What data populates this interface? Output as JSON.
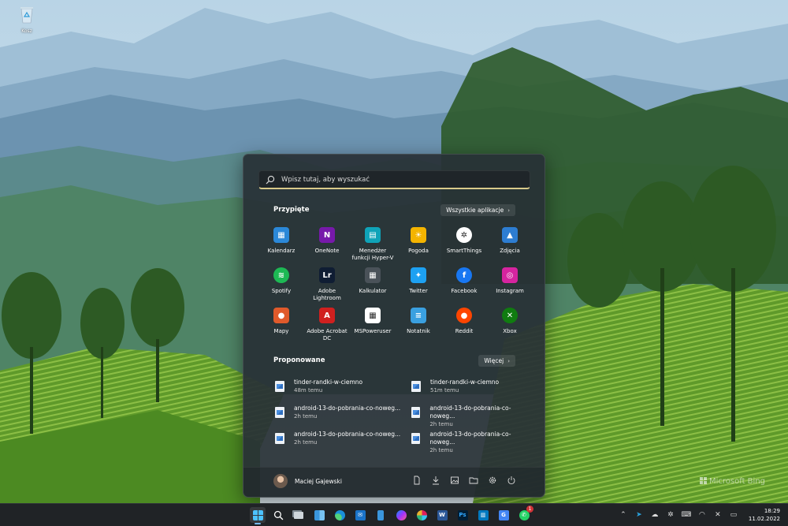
{
  "desktop": {
    "recycle_bin_label": "Kosz",
    "watermark": "Microsoft Bing"
  },
  "start_menu": {
    "search": {
      "placeholder": "Wpisz tutaj, aby wyszukać"
    },
    "pinned": {
      "title": "Przypięte",
      "all_apps_label": "Wszystkie aplikacje",
      "apps": [
        {
          "name": "Kalendarz",
          "icon": "calendar-icon",
          "color": "#2b88d8"
        },
        {
          "name": "OneNote",
          "icon": "onenote-icon",
          "color": "#7719aa"
        },
        {
          "name": "Menedżer funkcji Hyper-V",
          "icon": "hyperv-icon",
          "color": "#0fa3b8"
        },
        {
          "name": "Pogoda",
          "icon": "weather-icon",
          "color": "#f4b400"
        },
        {
          "name": "SmartThings",
          "icon": "smartthings-icon",
          "color": "#ffffff"
        },
        {
          "name": "Zdjęcia",
          "icon": "photos-icon",
          "color": "#2d7dd2"
        },
        {
          "name": "Spotify",
          "icon": "spotify-icon",
          "color": "#1db954"
        },
        {
          "name": "Adobe Lightroom",
          "icon": "lightroom-icon",
          "color": "#0f1d33"
        },
        {
          "name": "Kalkulator",
          "icon": "calculator-icon",
          "color": "#4a5259"
        },
        {
          "name": "Twitter",
          "icon": "twitter-icon",
          "color": "#1da1f2"
        },
        {
          "name": "Facebook",
          "icon": "facebook-icon",
          "color": "#1877f2"
        },
        {
          "name": "Instagram",
          "icon": "instagram-icon",
          "color": "#d6249f"
        },
        {
          "name": "Mapy",
          "icon": "maps-icon",
          "color": "#e05a2b"
        },
        {
          "name": "Adobe Acrobat DC",
          "icon": "acrobat-icon",
          "color": "#d0201f"
        },
        {
          "name": "MSPoweruser",
          "icon": "mspoweruser-icon",
          "color": "#ffffff"
        },
        {
          "name": "Notatnik",
          "icon": "notepad-icon",
          "color": "#3aa0e0"
        },
        {
          "name": "Reddit",
          "icon": "reddit-icon",
          "color": "#ff4500"
        },
        {
          "name": "Xbox",
          "icon": "xbox-icon",
          "color": "#107c10"
        }
      ]
    },
    "recommended": {
      "title": "Proponowane",
      "more_label": "Więcej",
      "items": [
        {
          "name": "tinder-randki-w-ciemno",
          "time": "48m temu"
        },
        {
          "name": "tinder-randki-w-ciemno",
          "time": "51m temu"
        },
        {
          "name": "android-13-do-pobrania-co-noweg...",
          "time": "2h temu"
        },
        {
          "name": "android-13-do-pobrania-co-noweg...",
          "time": "2h temu"
        },
        {
          "name": "android-13-do-pobrania-co-noweg...",
          "time": "2h temu"
        },
        {
          "name": "android-13-do-pobrania-co-noweg...",
          "time": "2h temu"
        }
      ]
    },
    "user": {
      "name": "Maciej Gajewski"
    }
  },
  "taskbar": {
    "notification_badge": "1",
    "clock": {
      "time": "18:29",
      "date": "11.02.2022"
    }
  },
  "colors": {
    "accent": "#76b9ed",
    "search_underline": "#d9c98a",
    "start_bg": "#283036",
    "taskbar_bg": "#202326"
  }
}
